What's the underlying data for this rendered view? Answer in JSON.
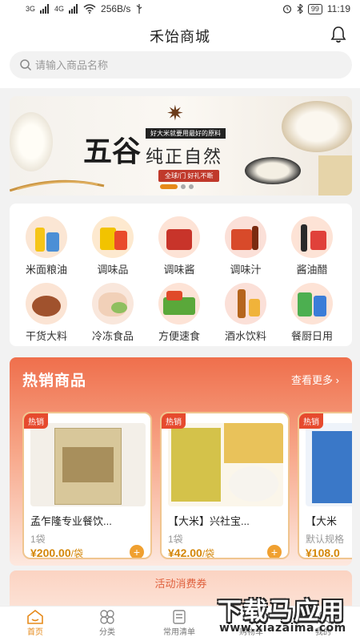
{
  "status_bar": {
    "network_1": "3G",
    "network_2": "4G",
    "speed": "256B/s",
    "battery": "99",
    "time": "11:19"
  },
  "header": {
    "title": "禾饴商城",
    "search_placeholder": "请输入商品名称"
  },
  "banner": {
    "headline": "五谷",
    "subtitle": "纯正自然",
    "small_text": "好大米就要用最好的原料",
    "tag": "全球/门 好礼不断",
    "slides": 3,
    "active_slide": 0
  },
  "categories": [
    {
      "label": "米面粮油",
      "icon": "rice-oil-icon"
    },
    {
      "label": "调味品",
      "icon": "seasoning-icon"
    },
    {
      "label": "调味酱",
      "icon": "sauce-icon"
    },
    {
      "label": "调味汁",
      "icon": "juice-sauce-icon"
    },
    {
      "label": "酱油醋",
      "icon": "soy-vinegar-icon"
    },
    {
      "label": "干货大料",
      "icon": "dried-goods-icon"
    },
    {
      "label": "冷冻食品",
      "icon": "frozen-food-icon"
    },
    {
      "label": "方便速食",
      "icon": "instant-food-icon"
    },
    {
      "label": "酒水饮料",
      "icon": "drinks-icon"
    },
    {
      "label": "餐厨日用",
      "icon": "kitchen-daily-icon"
    }
  ],
  "hot_section": {
    "title": "热销商品",
    "see_more": "查看更多 ›",
    "products": [
      {
        "badge": "热销",
        "name": "孟乍隆专业餐饮...",
        "qty": "1袋",
        "price": "¥200.00",
        "unit": "/袋"
      },
      {
        "badge": "热销",
        "name": "【大米】兴社宝...",
        "qty": "1袋",
        "price": "¥42.00",
        "unit": "/袋"
      },
      {
        "badge": "热销",
        "name": "【大米",
        "qty": "默认规格",
        "price": "¥108.0",
        "unit": ""
      }
    ]
  },
  "coupon": {
    "label": "活动消费券"
  },
  "tabbar": [
    {
      "label": "首页",
      "active": true
    },
    {
      "label": "分类",
      "active": false
    },
    {
      "label": "常用清单",
      "active": false
    },
    {
      "label": "购物车",
      "active": false
    },
    {
      "label": "我的",
      "active": false
    }
  ],
  "watermark": {
    "title": "下载马应用",
    "url": "www.xiazaima.com"
  },
  "colors": {
    "accent": "#e68a1a",
    "hot_red": "#e64a2e",
    "price": "#d4870a"
  }
}
